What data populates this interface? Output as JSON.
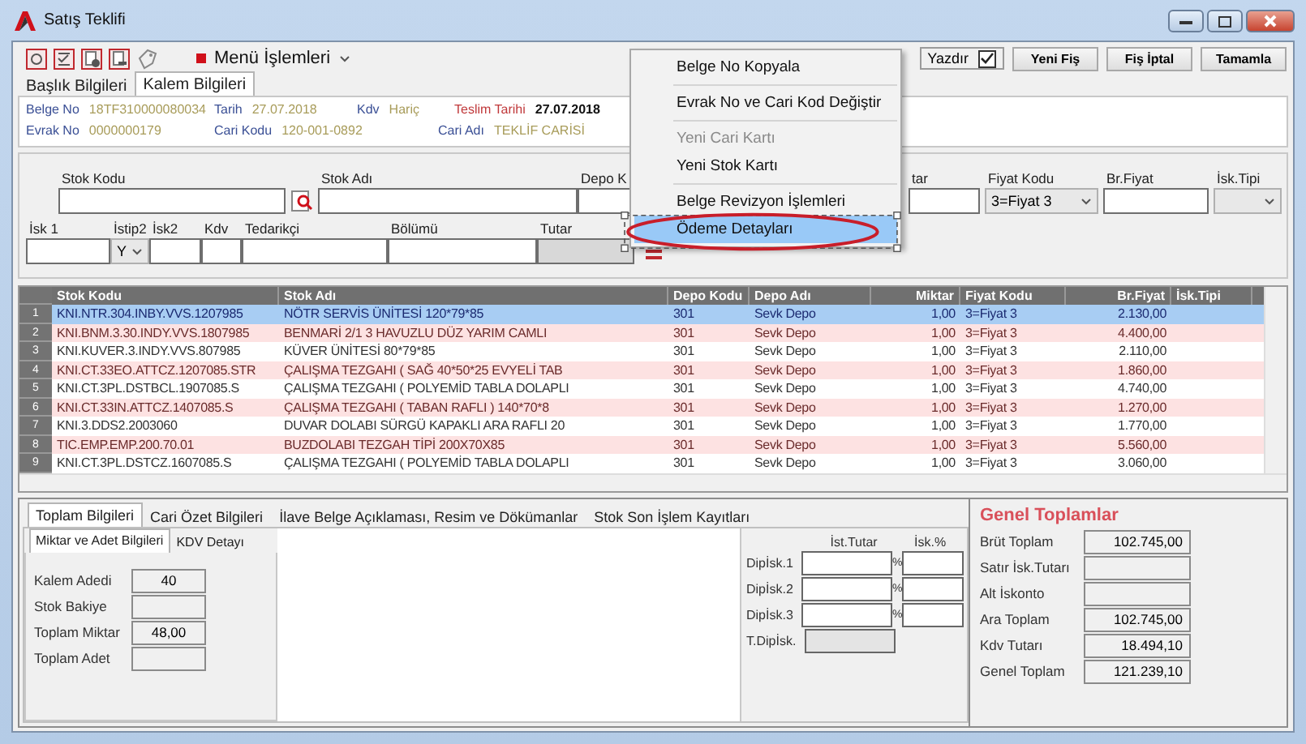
{
  "window": {
    "title": "Satış Teklifi"
  },
  "toolbar": {
    "menu_label": "Menü İşlemleri",
    "print": {
      "label": "Yazdır",
      "checked": true
    },
    "buttons": [
      "Yeni Fiş",
      "Fiş İptal",
      "Tamamla"
    ]
  },
  "context_menu": [
    {
      "label": "Belge No Kopyala",
      "disabled": false,
      "selected": false,
      "separator_after": true
    },
    {
      "label": "Evrak No ve Cari Kod Değiştir",
      "disabled": false,
      "selected": false,
      "separator_after": true
    },
    {
      "label": "Yeni Cari Kartı",
      "disabled": true,
      "selected": false,
      "separator_after": false
    },
    {
      "label": "Yeni Stok Kartı",
      "disabled": false,
      "selected": false,
      "separator_after": true
    },
    {
      "label": "Belge Revizyon İşlemleri",
      "disabled": false,
      "selected": false,
      "separator_after": false
    },
    {
      "label": "Ödeme Detayları",
      "disabled": false,
      "selected": true,
      "separator_after": false
    }
  ],
  "tabs": [
    {
      "label": "Başlık Bilgileri",
      "selected": false
    },
    {
      "label": "Kalem Bilgileri",
      "selected": true
    }
  ],
  "header_fields": [
    {
      "label": "Belge No",
      "value": "18TF310000080034",
      "kind": "normal"
    },
    {
      "label": "Tarih",
      "value": "27.07.2018",
      "kind": "normal"
    },
    {
      "label": "Kdv",
      "value": "Hariç",
      "kind": "normal"
    },
    {
      "label": "Teslim Tarihi",
      "value": "27.07.2018",
      "kind": "emphasis"
    },
    {
      "label": "Evrak No",
      "value": "0000000179",
      "kind": "normal"
    },
    {
      "label": "Cari Kodu",
      "value": "120-001-0892",
      "kind": "normal"
    },
    {
      "label": "Cari Adı",
      "value": "TEKLİF CARİSİ",
      "kind": "normal"
    }
  ],
  "form": {
    "row_1": [
      {
        "label": "Stok Kodu",
        "kind": "lookup"
      },
      {
        "label": "Stok Adı",
        "kind": "text"
      },
      {
        "label": "Depo K",
        "kind": "text"
      },
      {
        "label": "tar",
        "kind": "text"
      },
      {
        "label": "Fiyat Kodu",
        "kind": "select",
        "value": "3=Fiyat 3"
      },
      {
        "label": "Br.Fiyat",
        "kind": "text"
      },
      {
        "label": "İsk.Tipi",
        "kind": "select"
      }
    ],
    "row_2": [
      {
        "label": "İsk 1",
        "kind": "text"
      },
      {
        "label": "İstip2",
        "kind": "select",
        "value": "Y"
      },
      {
        "label": "İsk2",
        "kind": "text"
      },
      {
        "label": "Kdv",
        "kind": "text"
      },
      {
        "label": "Tedarikçi",
        "kind": "text"
      },
      {
        "label": "Bölümü",
        "kind": "text"
      },
      {
        "label": "Tutar",
        "kind": "readonly"
      }
    ]
  },
  "table": {
    "columns": [
      "Stok Kodu",
      "Stok Adı",
      "Depo Kodu",
      "Depo Adı",
      "Miktar",
      "Fiyat Kodu",
      "Br.Fiyat",
      "İsk.Tipi"
    ],
    "rows": [
      {
        "number": "1",
        "selected": true,
        "cells": [
          "KNI.NTR.304.INBY.VVS.1207985",
          "NÖTR SERVİS ÜNİTESİ  120*79*85",
          "301",
          "Sevk Depo",
          "1,00",
          "3=Fiyat 3",
          "2.130,00"
        ]
      },
      {
        "number": "2",
        "selected": false,
        "cells": [
          "KNI.BNM.3.30.INDY.VVS.1807985",
          "BENMARİ  2/1 3 HAVUZLU DÜZ YARIM CAMLI",
          "301",
          "Sevk Depo",
          "1,00",
          "3=Fiyat 3",
          "4.400,00"
        ]
      },
      {
        "number": "3",
        "selected": false,
        "cells": [
          "KNI.KUVER.3.INDY.VVS.807985",
          "KÜVER ÜNİTESİ  80*79*85",
          "301",
          "Sevk Depo",
          "1,00",
          "3=Fiyat 3",
          "2.110,00"
        ]
      },
      {
        "number": "4",
        "selected": false,
        "cells": [
          "KNI.CT.33EO.ATTCZ.1207085.STR",
          "ÇALIŞMA TEZGAHI ( SAĞ 40*50*25 EVYELİ TAB",
          "301",
          "Sevk Depo",
          "1,00",
          "3=Fiyat 3",
          "1.860,00"
        ]
      },
      {
        "number": "5",
        "selected": false,
        "cells": [
          "KNI.CT.3PL.DSTBCL.1907085.S",
          "ÇALIŞMA TEZGAHI ( POLYEMİD TABLA DOLAPLI",
          "301",
          "Sevk Depo",
          "1,00",
          "3=Fiyat 3",
          "4.740,00"
        ]
      },
      {
        "number": "6",
        "selected": false,
        "cells": [
          "KNI.CT.33IN.ATTCZ.1407085.S",
          "ÇALIŞMA TEZGAHI (  TABAN RAFLI  ) 140*70*8",
          "301",
          "Sevk Depo",
          "1,00",
          "3=Fiyat 3",
          "1.270,00"
        ]
      },
      {
        "number": "7",
        "selected": false,
        "cells": [
          "KNI.3.DDS2.2003060",
          "DUVAR DOLABI SÜRGÜ KAPAKLI ARA RAFLI 20",
          "301",
          "Sevk Depo",
          "1,00",
          "3=Fiyat 3",
          "1.770,00"
        ]
      },
      {
        "number": "8",
        "selected": false,
        "cells": [
          "TIC.EMP.EMP.200.70.01",
          "BUZDOLABI TEZGAH TİPİ 200X70X85",
          "301",
          "Sevk Depo",
          "1,00",
          "3=Fiyat 3",
          "5.560,00"
        ]
      },
      {
        "number": "9",
        "selected": false,
        "cells": [
          "KNI.CT.3PL.DSTCZ.1607085.S",
          "ÇALIŞMA TEZGAHI ( POLYEMİD TABLA DOLAPLI",
          "301",
          "Sevk Depo",
          "1,00",
          "3=Fiyat 3",
          "3.060,00"
        ]
      }
    ]
  },
  "bottom_tabs": [
    {
      "label": "Toplam Bilgileri",
      "selected": true
    },
    {
      "label": "Cari Özet Bilgileri",
      "selected": false
    },
    {
      "label": "İlave Belge Açıklaması, Resim ve Dökümanlar",
      "selected": false
    },
    {
      "label": "Stok Son İşlem Kayıtları",
      "selected": false
    }
  ],
  "sub_tabs": [
    {
      "label": "Miktar ve Adet Bilgileri",
      "selected": true
    },
    {
      "label": "KDV Detayı",
      "selected": false
    }
  ],
  "quantities": [
    {
      "label": "Kalem Adedi",
      "value": "40"
    },
    {
      "label": "Stok Bakiye"
    },
    {
      "label": "Toplam Miktar",
      "value": "48,00"
    },
    {
      "label": "Toplam Adet"
    }
  ],
  "discounts": {
    "columns": [
      "İst.Tutar",
      "İsk.%"
    ],
    "rows": [
      {
        "label": "Dipİsk.1",
        "sign": "%"
      },
      {
        "label": "Dipİsk.2",
        "sign": "%"
      },
      {
        "label": "Dipİsk.3",
        "sign": "%"
      }
    ],
    "total_label": "T.Dipİsk."
  },
  "totals": {
    "title": "Genel Toplamlar",
    "rows": [
      {
        "label": "Brüt Toplam",
        "value": "102.745,00"
      },
      {
        "label": "Satır İsk.Tutarı"
      },
      {
        "label": "Alt İskonto"
      },
      {
        "label": "Ara Toplam",
        "value": "102.745,00"
      },
      {
        "label": "Kdv Tutarı",
        "value": "18.494,10"
      },
      {
        "label": "Genel Toplam",
        "value": "121.239,10"
      }
    ]
  }
}
